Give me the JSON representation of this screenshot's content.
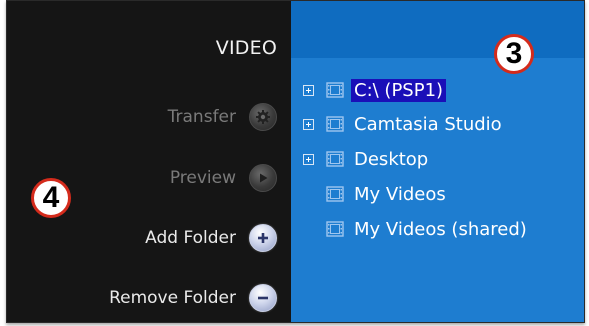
{
  "left_panel": {
    "title": "VIDEO",
    "actions": [
      {
        "label": "Transfer",
        "icon": "gear-icon",
        "enabled": false
      },
      {
        "label": "Preview",
        "icon": "play-icon",
        "enabled": false
      },
      {
        "label": "Add Folder",
        "icon": "plus-icon",
        "enabled": true
      },
      {
        "label": "Remove Folder",
        "icon": "minus-icon",
        "enabled": true
      }
    ]
  },
  "tree": {
    "items": [
      {
        "label": "C:\\ (PSP1)",
        "expandable": true,
        "selected": true
      },
      {
        "label": "Camtasia Studio",
        "expandable": true,
        "selected": false
      },
      {
        "label": "Desktop",
        "expandable": true,
        "selected": false
      },
      {
        "label": "My Videos",
        "expandable": false,
        "selected": false
      },
      {
        "label": "My Videos (shared)",
        "expandable": false,
        "selected": false
      }
    ]
  },
  "callouts": {
    "tree_callout": "3",
    "actions_callout": "4"
  },
  "colors": {
    "left_background": "#151515",
    "right_background": "#1e7dd0",
    "selection": "#1a0fb8",
    "callout_border": "#d42b1c"
  }
}
